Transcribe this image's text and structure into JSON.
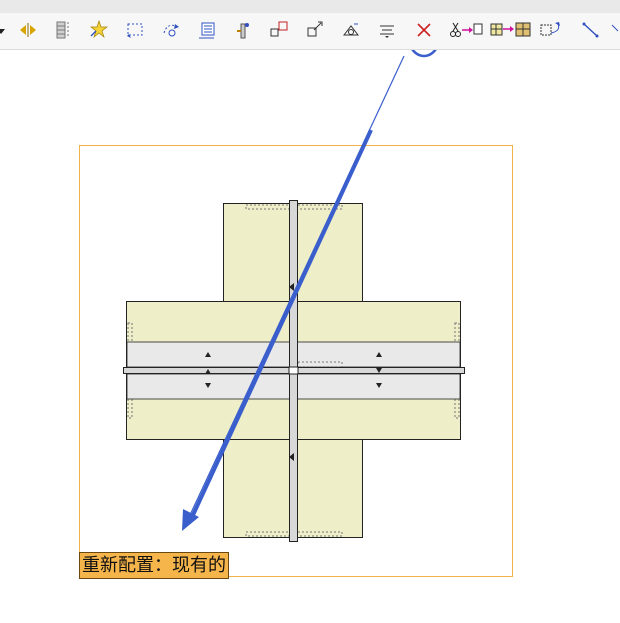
{
  "toolbar": {
    "buttons": [
      {
        "name": "dropdown-arrow-icon"
      },
      {
        "name": "flip-horizontal-icon"
      },
      {
        "name": "column-layers-icon"
      },
      {
        "name": "star-sparkle-icon"
      },
      {
        "name": "select-rectangle-icon"
      },
      {
        "name": "rotate-selection-icon"
      },
      {
        "name": "list-panel-icon"
      },
      {
        "name": "connector-post-icon"
      },
      {
        "name": "scale-boxes-icon"
      },
      {
        "name": "resize-arrows-icon"
      },
      {
        "name": "anchor-settings-icon"
      },
      {
        "name": "align-text-icon"
      },
      {
        "name": "delete-x-icon",
        "highlighted": true
      },
      {
        "name": "cut-copy-icon"
      },
      {
        "name": "grid-transfer-icon"
      },
      {
        "name": "rotate-copy-icon"
      },
      {
        "name": "diagonal-line-icon"
      }
    ]
  },
  "annotation": {
    "highlight_color": "#3a5fcd"
  },
  "colors": {
    "frame": "#f2b24a",
    "slab_fill": "#eeeec8",
    "band_fill": "#e9e9e9",
    "outline": "#222222",
    "label_bg": "#f5b54a"
  },
  "status_label": {
    "text": "重新配置：现有的"
  }
}
